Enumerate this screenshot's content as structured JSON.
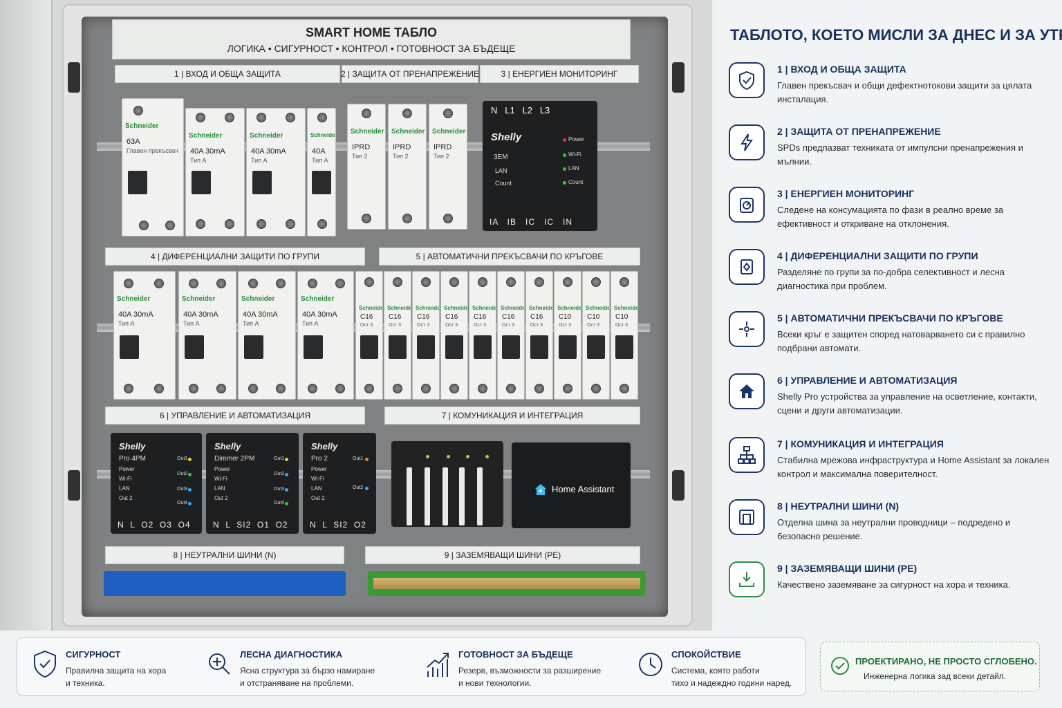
{
  "cabinet": {
    "title": "SMART HOME ТАБЛО",
    "subtitle": "ЛОГИКА • СИГУРНОСТ • КОНТРОЛ • ГОТОВНОСТ ЗА БЪДЕЩЕ",
    "section_labels": [
      "1 | ВХОД И ОБЩА ЗАЩИТА",
      "2 | ЗАЩИТА ОТ ПРЕНАПРЕЖЕНИЕ",
      "3 | ЕНЕРГИЕН МОНИТОРИНГ",
      "4 | ДИФЕРЕНЦИАЛНИ ЗАЩИТИ ПО ГРУПИ",
      "5 | АВТОМАТИЧНИ ПРЕКЪСВАЧИ ПО КРЪГОВЕ",
      "6 | УПРАВЛЕНИЕ И АВТОМАТИЗАЦИЯ",
      "7 | КОМУНИКАЦИЯ И ИНТЕГРАЦИЯ",
      "8 | НЕУТРАЛНИ ШИНИ (N)",
      "9 | ЗАЗЕМЯВАЩИ ШИНИ (PE)"
    ],
    "brand": "Schneider",
    "main_breaker": {
      "rating": "63A",
      "sub": "Главен прекъсвач"
    },
    "rcd_top": [
      {
        "rating": "40A  30mA",
        "sub": "Тип А"
      },
      {
        "rating": "40A  30mA",
        "sub": "Тип А"
      },
      {
        "rating": "40A",
        "sub": "Тип А"
      }
    ],
    "spd": [
      {
        "rating": "IPRD",
        "sub": "Тип 2"
      },
      {
        "rating": "IPRD",
        "sub": "Тип 2"
      },
      {
        "rating": "IPRD",
        "sub": "Тип 2"
      }
    ],
    "meter": {
      "logo": "Shelly",
      "model": "3EM",
      "top_terminals": "N   L1   L2   L3",
      "bottom_terminals": "IA   IB   IC   IC   IN",
      "left_labels": [
        "LAN",
        "Count"
      ],
      "indicators": [
        "Power",
        "Wi-Fi",
        "LAN",
        "Count"
      ]
    },
    "rcd_groups": [
      {
        "rating": "40A  30mA",
        "sub": "Тип А"
      },
      {
        "rating": "40A  30mA",
        "sub": "Тип А"
      },
      {
        "rating": "40A  30mA",
        "sub": "Тип А"
      },
      {
        "rating": "40A  30mA",
        "sub": "Тип А"
      }
    ],
    "mcbs": [
      "C16",
      "C16",
      "C16",
      "C16",
      "C16",
      "C16",
      "C16",
      "C10",
      "C10",
      "C10"
    ],
    "mcb_sub": "Ост 3",
    "shelly_devices": [
      {
        "logo": "Shelly",
        "model": "Pro 4PM",
        "terminals": "N  L  O2  O3  O4",
        "labels": [
          "Power",
          "Wi-Fi",
          "LAN",
          "Out 2"
        ],
        "outs": [
          "Out1",
          "Out2",
          "Out3",
          "Out4"
        ]
      },
      {
        "logo": "Shelly",
        "model": "Dimmer 2PM",
        "terminals": "N  L  SI2  O1  O2",
        "labels": [
          "Power",
          "Wi-Fi",
          "LAN",
          "Out 2"
        ],
        "outs": [
          "Out1",
          "Out2",
          "Out3",
          "Out4"
        ]
      },
      {
        "logo": "Shelly",
        "model": "Pro 2",
        "terminals": "N  L  SI2  O2",
        "labels": [
          "Power",
          "Wi-Fi",
          "LAN",
          "Out 2"
        ],
        "outs": [
          "Out1",
          "Out2"
        ]
      }
    ],
    "home_assistant": "Home Assistant"
  },
  "panel": {
    "title": "ТАБЛОТО, КОЕТО МИСЛИ ЗА ДНЕС И ЗА УТРЕ",
    "items": [
      {
        "icon": "shield-check-icon",
        "title": "1 | ВХОД И ОБЩА ЗАЩИТА",
        "desc": "Главен прекъсвач и общи дефектнотокови защити за цялата инсталация."
      },
      {
        "icon": "lightning-icon",
        "title": "2 | ЗАЩИТА ОТ ПРЕНАПРЕЖЕНИЕ",
        "desc": "SPDs предпазват техниката от импулсни пренапрежения и мълнии."
      },
      {
        "icon": "energy-meter-icon",
        "title": "3 | ЕНЕРГИЕН МОНИТОРИНГ",
        "desc": "Следене на консумацията по фази в реално време за ефективност и откриване на отклонения."
      },
      {
        "icon": "rcd-icon",
        "title": "4 | ДИФЕРЕНЦИАЛНИ ЗАЩИТИ ПО ГРУПИ",
        "desc": "Разделяне по групи за по-добра селективност и лесна диагностика при проблем."
      },
      {
        "icon": "distribution-icon",
        "title": "5 | АВТОМАТИЧНИ ПРЕКЪСВАЧИ ПО КРЪГОВЕ",
        "desc": "Всеки кръг е защитен според натоварването си с правилно подбрани автомати."
      },
      {
        "icon": "home-icon",
        "title": "6 | УПРАВЛЕНИЕ И АВТОМАТИЗАЦИЯ",
        "desc": "Shelly Pro устройства за управление на осветление, контакти, сцени и други автоматизации."
      },
      {
        "icon": "network-icon",
        "title": "7 | КОМУНИКАЦИЯ И ИНТЕГРАЦИЯ",
        "desc": "Стабилна мрежова инфраструктура и Home Assistant за локален контрол и максимална поверителност."
      },
      {
        "icon": "neutral-bus-icon",
        "title": "8 | НЕУТРАЛНИ ШИНИ (N)",
        "desc": "Отделна шина за неутрални проводници – подредено и безопасно решение."
      },
      {
        "icon": "ground-icon",
        "title": "9 | ЗАЗЕМЯВАЩИ ШИНИ (PE)",
        "desc": "Качествено заземяване за сигурност на хора и техника."
      }
    ]
  },
  "footer": {
    "features": [
      {
        "icon": "shield-check-icon",
        "title": "СИГУРНОСТ",
        "desc1": "Правилна защита на хора",
        "desc2": "и техника."
      },
      {
        "icon": "magnifier-plus-icon",
        "title": "ЛЕСНА ДИАГНОСТИКА",
        "desc1": "Ясна структура за бързо намиране",
        "desc2": "и отстраняване на проблеми."
      },
      {
        "icon": "growth-chart-icon",
        "title": "ГОТОВНОСТ ЗА БЪДЕЩЕ",
        "desc1": "Резерв, възможности за разширение",
        "desc2": "и нови технологии."
      },
      {
        "icon": "clock-icon",
        "title": "СПОКОЙСТВИЕ",
        "desc1": "Система, която работи",
        "desc2": "тихо и надеждно години наред."
      }
    ],
    "badge": {
      "title": "ПРОЕКТИРАНО, НЕ ПРОСТО СГЛОБЕНО.",
      "desc": "Инженерна логика зад всеки детайл."
    }
  },
  "colors": {
    "navy": "#17305c",
    "green": "#2f8a44",
    "blue_bus": "#1f5fbf",
    "green_bus": "#3a9a3a"
  }
}
